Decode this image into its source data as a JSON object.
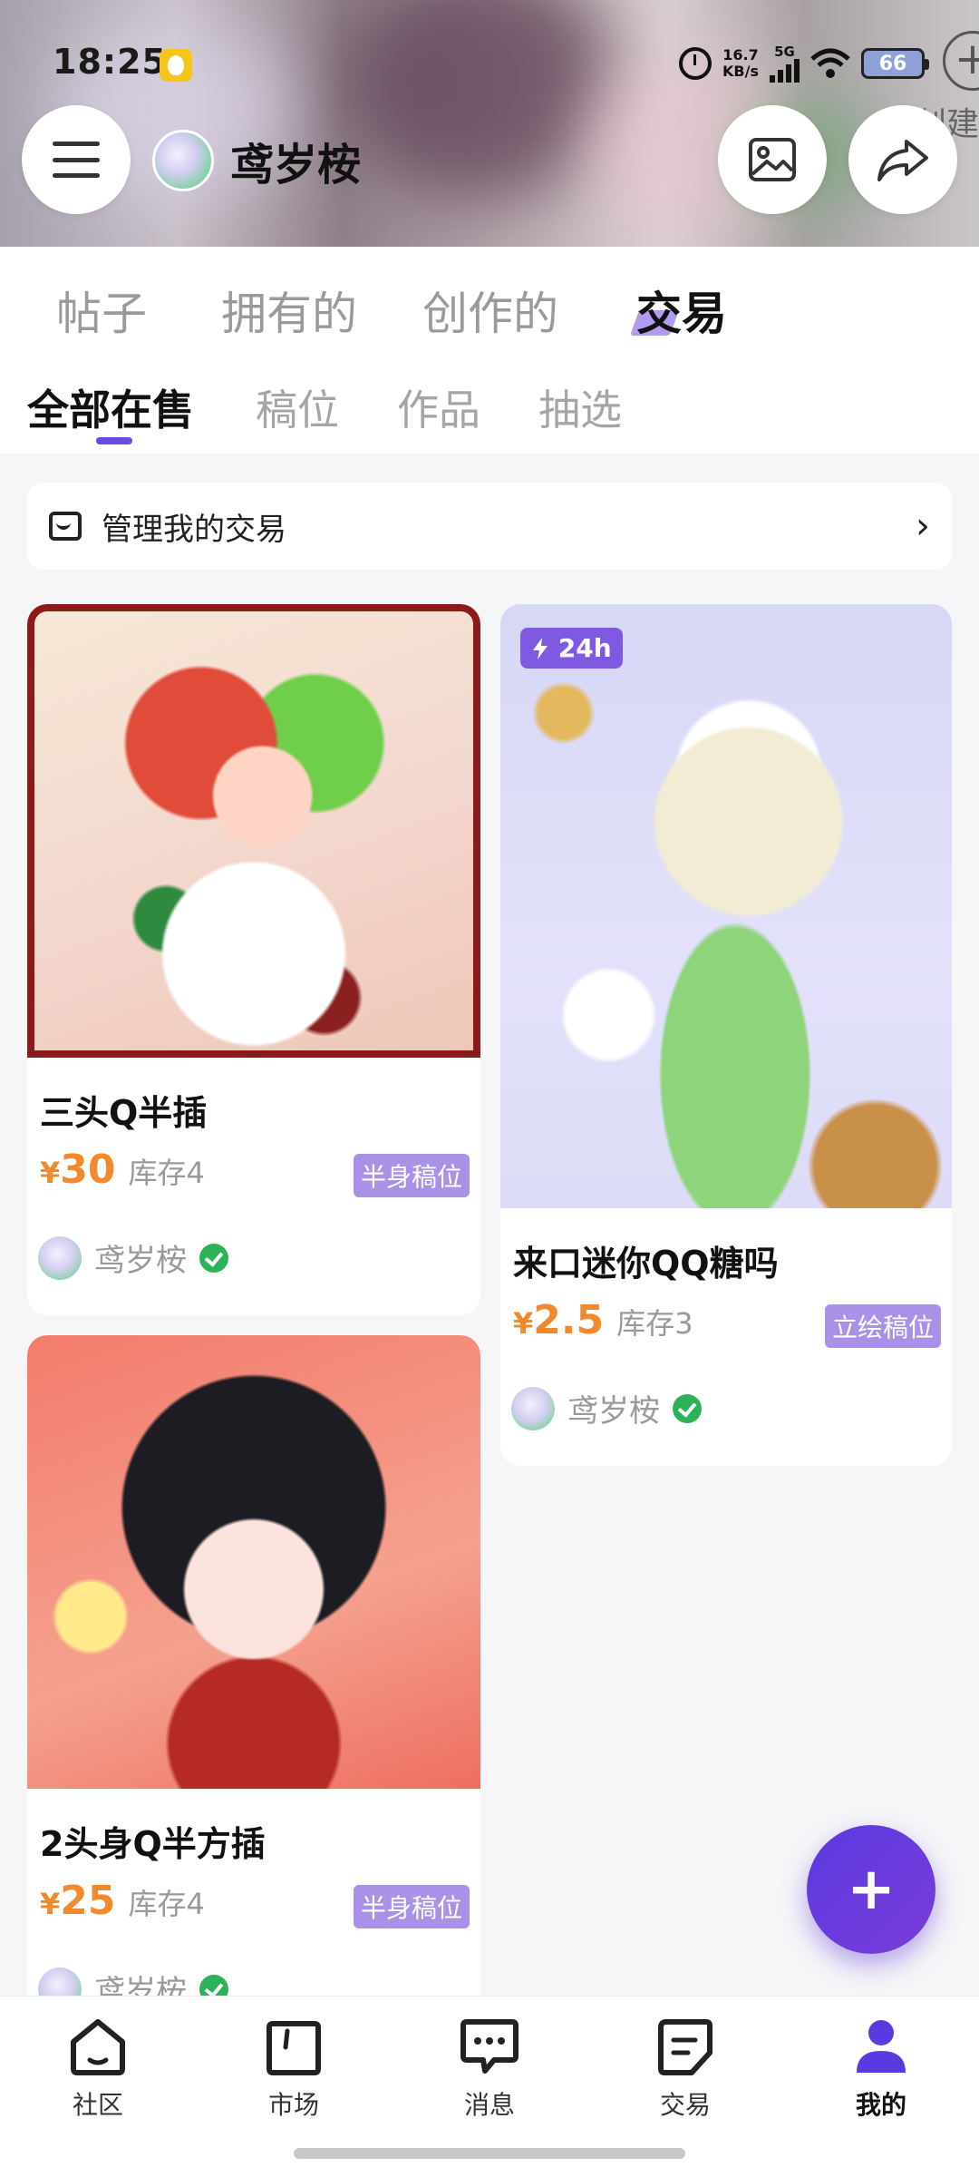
{
  "status_bar": {
    "time": "18:25",
    "net_speed_value": "16.7",
    "net_speed_unit": "KB/s",
    "network": "5G",
    "battery": "66"
  },
  "header": {
    "create_label": "创建",
    "profile_name": "鸢岁桉",
    "menu_icon": "hamburger-icon",
    "image_icon": "image-icon",
    "share_icon": "share-icon"
  },
  "main_tabs": [
    {
      "label": "帖子",
      "active": false
    },
    {
      "label": "拥有的",
      "active": false
    },
    {
      "label": "创作的",
      "active": false
    },
    {
      "label": "交易",
      "active": true
    }
  ],
  "sub_tabs": [
    {
      "label": "全部在售",
      "active": true
    },
    {
      "label": "稿位",
      "active": false
    },
    {
      "label": "作品",
      "active": false
    },
    {
      "label": "抽选",
      "active": false
    }
  ],
  "manage": {
    "label": "管理我的交易",
    "icon": "store-icon",
    "chevron": "›"
  },
  "products": [
    {
      "title": "三头Q半插",
      "currency": "¥",
      "price": "30",
      "stock": "库存4",
      "tag": "半身稿位",
      "seller": "鸢岁桉",
      "verified": true,
      "badge": ""
    },
    {
      "title": "来口迷你QQ糖吗",
      "currency": "¥",
      "price": "2.5",
      "stock": "库存3",
      "tag": "立绘稿位",
      "seller": "鸢岁桉",
      "verified": true,
      "badge": "24h"
    },
    {
      "title": "2头身Q半方插",
      "currency": "¥",
      "price": "25",
      "stock": "库存4",
      "tag": "半身稿位",
      "seller": "鸢岁桉",
      "verified": true,
      "badge": ""
    }
  ],
  "fab": {
    "label": "+"
  },
  "bottom_nav": [
    {
      "label": "社区",
      "icon": "home-icon",
      "active": false
    },
    {
      "label": "市场",
      "icon": "bag-icon",
      "active": false
    },
    {
      "label": "消息",
      "icon": "message-icon",
      "active": false
    },
    {
      "label": "交易",
      "icon": "trade-icon",
      "active": false
    },
    {
      "label": "我的",
      "icon": "person-icon",
      "active": true
    }
  ],
  "colors": {
    "accent": "#6a4ce0",
    "price": "#f08a2c",
    "tag": "#a891e6",
    "verified": "#2cb35a"
  }
}
